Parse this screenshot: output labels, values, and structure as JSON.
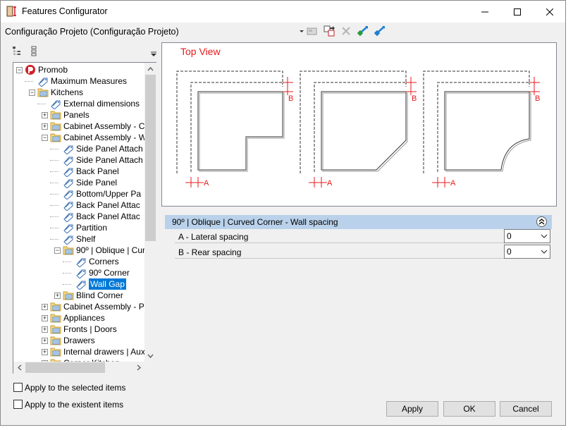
{
  "window": {
    "title": "Features Configurator"
  },
  "configuration": {
    "label": "Configuração Projeto (Configuração Projeto)"
  },
  "tree": [
    {
      "label": "Promob",
      "level": 0,
      "expander": "−",
      "icon": "promob-logo-icon"
    },
    {
      "label": "Maximum Measures",
      "level": 1,
      "expander": "",
      "icon": "tag-icon"
    },
    {
      "label": "Kitchens",
      "level": 1,
      "expander": "−",
      "icon": "folder-icon"
    },
    {
      "label": "External dimensions",
      "level": 2,
      "expander": "",
      "icon": "tag-icon"
    },
    {
      "label": "Panels",
      "level": 2,
      "expander": "+",
      "icon": "folder-icon"
    },
    {
      "label": "Cabinet Assembly - Ca",
      "level": 2,
      "expander": "+",
      "icon": "folder-icon"
    },
    {
      "label": "Cabinet Assembly - W",
      "level": 2,
      "expander": "−",
      "icon": "folder-icon"
    },
    {
      "label": "Side Panel Attach",
      "level": 3,
      "expander": "",
      "icon": "tag-icon"
    },
    {
      "label": " Side Panel Attach",
      "level": 3,
      "expander": "",
      "icon": "tag-icon"
    },
    {
      "label": "Back Panel",
      "level": 3,
      "expander": "",
      "icon": "tag-icon"
    },
    {
      "label": "Side Panel",
      "level": 3,
      "expander": "",
      "icon": "tag-icon"
    },
    {
      "label": " Bottom/Upper Pa",
      "level": 3,
      "expander": "",
      "icon": "tag-icon"
    },
    {
      "label": "Back Panel Attac",
      "level": 3,
      "expander": "",
      "icon": "tag-icon"
    },
    {
      "label": "Back Panel Attac",
      "level": 3,
      "expander": "",
      "icon": "tag-icon"
    },
    {
      "label": "Partition",
      "level": 3,
      "expander": "",
      "icon": "tag-icon"
    },
    {
      "label": "Shelf",
      "level": 3,
      "expander": "",
      "icon": "tag-icon"
    },
    {
      "label": "90º | Oblique | Cur",
      "level": 3,
      "expander": "−",
      "icon": "folder-icon"
    },
    {
      "label": "Corners",
      "level": 4,
      "expander": "",
      "icon": "tag-icon"
    },
    {
      "label": "90º Corner",
      "level": 4,
      "expander": "",
      "icon": "tag-icon"
    },
    {
      "label": "Wall Gap",
      "level": 4,
      "expander": "",
      "icon": "tag-icon",
      "selected": true
    },
    {
      "label": "Blind Corner",
      "level": 3,
      "expander": "+",
      "icon": "folder-icon"
    },
    {
      "label": "Cabinet Assembly - Pa",
      "level": 2,
      "expander": "+",
      "icon": "folder-icon"
    },
    {
      "label": "Appliances",
      "level": 2,
      "expander": "+",
      "icon": "folder-icon"
    },
    {
      "label": "Fronts | Doors",
      "level": 2,
      "expander": "+",
      "icon": "folder-icon"
    },
    {
      "label": "Drawers",
      "level": 2,
      "expander": "+",
      "icon": "folder-icon"
    },
    {
      "label": "Internal drawers | Auxi",
      "level": 2,
      "expander": "+",
      "icon": "folder-icon"
    },
    {
      "label": "Corner Kitchen",
      "level": 2,
      "expander": "+",
      "icon": "folder-icon"
    }
  ],
  "preview": {
    "title": "Top View",
    "label_a": "A",
    "label_b": "B"
  },
  "properties": {
    "group_title": "90º | Oblique | Curved Corner - Wall spacing",
    "rows": [
      {
        "name": "A - Lateral spacing",
        "value": "0"
      },
      {
        "name": "B - Rear spacing",
        "value": "0"
      }
    ]
  },
  "options": {
    "apply_selected": "Apply to the selected items",
    "apply_existent": "Apply to the existent items"
  },
  "buttons": {
    "apply": "Apply",
    "ok": "OK",
    "cancel": "Cancel"
  },
  "colors": {
    "accent_red": "#e8191c",
    "selection": "#0078d7",
    "group_header": "#b9d1ea"
  }
}
